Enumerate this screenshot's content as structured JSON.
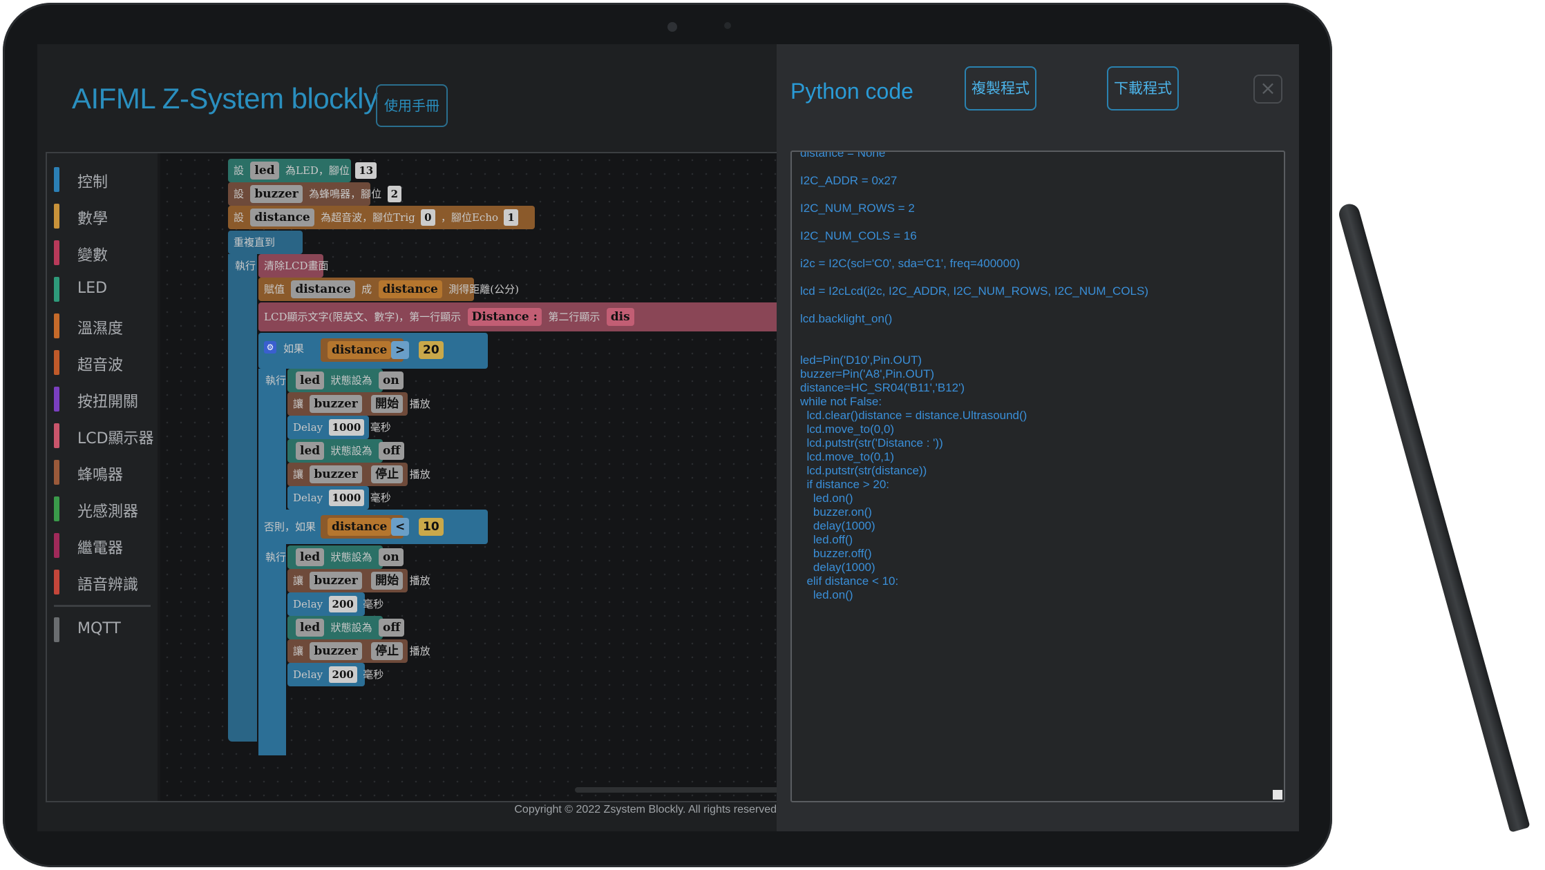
{
  "app": {
    "title": "AIFML Z-System blockly",
    "manual_button": "使用手冊",
    "footer": "Copyright © 2022 Zsystem Blockly. All rights reserved"
  },
  "toolbox": [
    {
      "label": "控制",
      "color": "#2b7fb5"
    },
    {
      "label": "數學",
      "color": "#c8923a"
    },
    {
      "label": "變數",
      "color": "#b83a5a"
    },
    {
      "label": "LED",
      "color": "#2e9a7a"
    },
    {
      "label": "溫濕度",
      "color": "#c56a2a"
    },
    {
      "label": "超音波",
      "color": "#c05a2a"
    },
    {
      "label": "按扭開關",
      "color": "#7a3fbf"
    },
    {
      "label": "LCD顯示器",
      "color": "#c9556b"
    },
    {
      "label": "蜂鳴器",
      "color": "#9a5a3a"
    },
    {
      "label": "光感測器",
      "color": "#3a9a4a"
    },
    {
      "label": "繼電器",
      "color": "#a02a5a"
    },
    {
      "label": "語音辨識",
      "color": "#c4463a"
    }
  ],
  "toolbox_extra": {
    "label": "MQTT",
    "color": "#6a6d70"
  },
  "blocks": {
    "set_led": {
      "a": "設",
      "var": "led",
      "b": "為LED，腳位",
      "pin": "13"
    },
    "set_buzzer": {
      "a": "設",
      "var": "buzzer",
      "b": "為蜂鳴器，腳位",
      "pin": "2"
    },
    "set_distance": {
      "a": "設",
      "var": "distance",
      "b": "為超音波，腳位Trig",
      "trig": "0",
      "c": "，腳位Echo",
      "echo": "1"
    },
    "repeat": {
      "label": "重複直到"
    },
    "exec1": "執行",
    "lcd_clear": "清除LCD畫面",
    "assign": {
      "a": "賦值",
      "var": "distance",
      "b": "成",
      "var2": "distance",
      "c": "測得距離(公分)"
    },
    "lcd_show": {
      "a": "LCD顯示文字(限英文、數字)，第一行顯示",
      "text": "Distance :",
      "b": "第二行顯示",
      "c": "dis"
    },
    "if1": {
      "label": "如果",
      "var": "distance",
      "op": ">",
      "val": "20"
    },
    "exec2": "執行",
    "led_on1": {
      "var": "led",
      "a": "狀態設為",
      "state": "on"
    },
    "buzzer_start1": {
      "a": "讓",
      "var": "buzzer",
      "mode": "開始",
      "b": "播放"
    },
    "delay1": {
      "a": "Delay",
      "ms": "1000",
      "b": "毫秒"
    },
    "led_off1": {
      "var": "led",
      "a": "狀態設為",
      "state": "off"
    },
    "buzzer_stop1": {
      "a": "讓",
      "var": "buzzer",
      "mode": "停止",
      "b": "播放"
    },
    "delay2": {
      "a": "Delay",
      "ms": "1000",
      "b": "毫秒"
    },
    "elseif": {
      "label": "否則，如果",
      "var": "distance",
      "op": "<",
      "val": "10"
    },
    "exec3": "執行",
    "led_on2": {
      "var": "led",
      "a": "狀態設為",
      "state": "on"
    },
    "buzzer_start2": {
      "a": "讓",
      "var": "buzzer",
      "mode": "開始",
      "b": "播放"
    },
    "delay3": {
      "a": "Delay",
      "ms": "200",
      "b": "毫秒"
    },
    "led_off2": {
      "var": "led",
      "a": "狀態設為",
      "state": "off"
    },
    "buzzer_stop2": {
      "a": "讓",
      "var": "buzzer",
      "mode": "停止",
      "b": "播放"
    },
    "delay4": {
      "a": "Delay",
      "ms": "200",
      "b": "毫秒"
    }
  },
  "panel": {
    "title": "Python code",
    "copy_button": "複製程式",
    "download_button": "下載程式",
    "close_icon": "×"
  },
  "code_lines": [
    "distance = None",
    "",
    "I2C_ADDR = 0x27",
    "",
    "I2C_NUM_ROWS = 2",
    "",
    "I2C_NUM_COLS = 16",
    "",
    "i2c = I2C(scl='C0', sda='C1', freq=400000)",
    "",
    "lcd = I2cLcd(i2c, I2C_ADDR, I2C_NUM_ROWS, I2C_NUM_COLS)",
    "",
    "lcd.backlight_on()",
    "",
    "",
    "led=Pin('D10',Pin.OUT)",
    "buzzer=Pin('A8',Pin.OUT)",
    "distance=HC_SR04('B11','B12')",
    "while not False:",
    "  lcd.clear()distance = distance.Ultrasound()",
    "  lcd.move_to(0,0)",
    "  lcd.putstr(str('Distance : '))",
    "  lcd.move_to(0,1)",
    "  lcd.putstr(str(distance))",
    "  if distance > 20:",
    "    led.on()",
    "    buzzer.on()",
    "    delay(1000)",
    "    led.off()",
    "    buzzer.off()",
    "    delay(1000)",
    "  elif distance < 10:",
    "    led.on()"
  ]
}
